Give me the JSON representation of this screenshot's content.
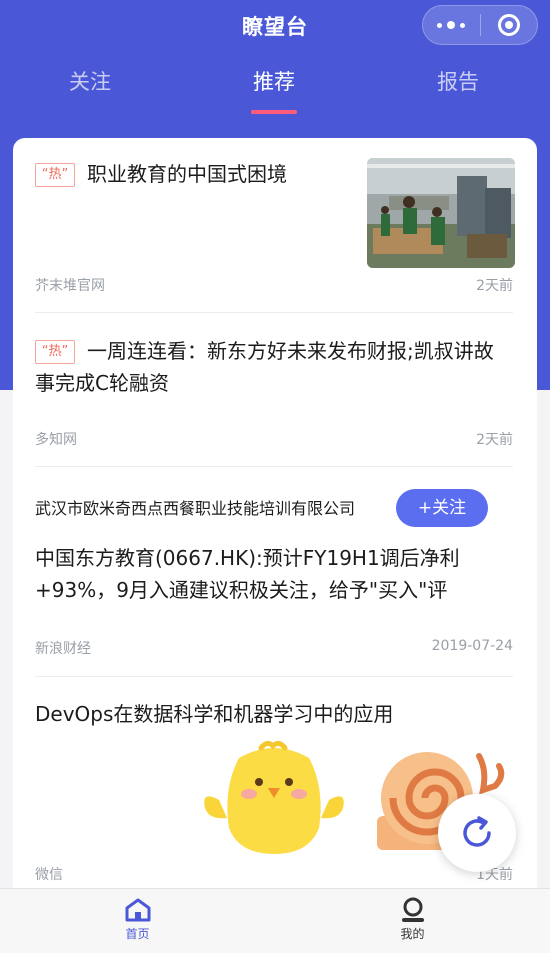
{
  "app": {
    "title": "瞭望台"
  },
  "tabs": [
    {
      "label": "关注",
      "active": false
    },
    {
      "label": "推荐",
      "active": true
    },
    {
      "label": "报告",
      "active": false
    }
  ],
  "feed": [
    {
      "hot_badge": "“热”",
      "title": "职业教育的中国式困境",
      "source": "芥末堆官网",
      "time": "2天前",
      "has_thumbnail": true
    },
    {
      "hot_badge": "“热”",
      "title": "一周连连看：新东方好未来发布财报;凯叔讲故事完成C轮融资",
      "source": "多知网",
      "time": "2天前"
    },
    {
      "company": "武汉市欧米奇西点西餐职业技能培训有限公司",
      "follow_label": "+关注",
      "title": "中国东方教育(0667.HK):预计FY19H1调后净利+93%，9月入通建议积极关注，给予\"买入\"评",
      "source": "新浪财经",
      "time": "2019-07-24"
    },
    {
      "title": "DevOps在数据科学和机器学习中的应用",
      "source": "微信",
      "time": "1天前"
    }
  ],
  "bottom_nav": [
    {
      "label": "首页",
      "icon": "home-icon",
      "active": true
    },
    {
      "label": "我的",
      "icon": "profile-icon",
      "active": false
    }
  ],
  "colors": {
    "brand": "#4a58d8",
    "accent": "#5b6ef0",
    "hot": "#f06a5a",
    "indicator": "#ff5b7a"
  }
}
